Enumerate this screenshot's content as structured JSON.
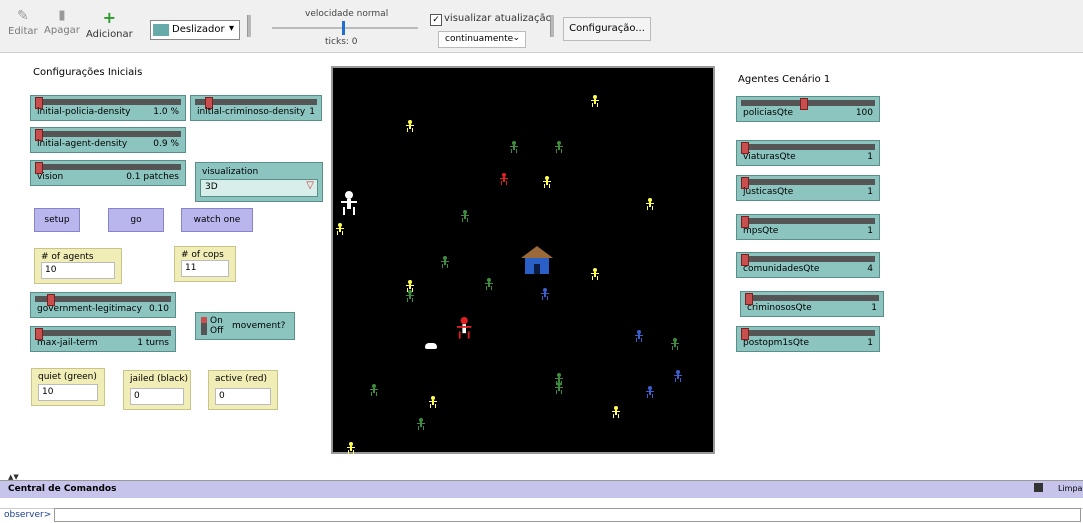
{
  "toolbar": {
    "edit_label": "Editar",
    "delete_label": "Apagar",
    "add_label": "Adicionar",
    "widget_type": "Deslizador",
    "speed_label": "velocidade normal",
    "ticks_label": "ticks: 0",
    "view_updates_label": "visualizar atualização",
    "view_updates_checked": true,
    "update_mode": "continuamente",
    "settings_label": "Configuração..."
  },
  "left_panel": {
    "title": "Configurações Iniciais",
    "sliders": {
      "initial_policia": {
        "name": "initial-policia-density",
        "value": "1.0 %",
        "level": 0.01
      },
      "initial_criminoso": {
        "name": "initial-criminoso-density",
        "value": "1",
        "level": 0.01
      },
      "initial_agent": {
        "name": "initial-agent-density",
        "value": "0.9 %",
        "level": 0.009
      },
      "vision": {
        "name": "vision",
        "value": "0.1 patches",
        "level": 0.0
      },
      "government_legitimacy": {
        "name": "government-legitimacy",
        "value": "0.10",
        "level": 0.1
      },
      "max_jail_term": {
        "name": "max-jail-term",
        "value": "1 turns",
        "level": 0.0
      }
    },
    "chooser": {
      "label": "visualization",
      "value": "3D"
    },
    "buttons": {
      "setup": "setup",
      "go": "go",
      "watch_one": "watch one"
    },
    "monitors": {
      "agents": {
        "label": "# of agents",
        "value": "10"
      },
      "cops": {
        "label": "# of cops",
        "value": "11"
      },
      "quiet": {
        "label": "quiet (green)",
        "value": "10"
      },
      "jailed": {
        "label": "jailed (black)",
        "value": "0"
      },
      "active": {
        "label": "active (red)",
        "value": "0"
      }
    },
    "switch": {
      "on": "On",
      "off": "Off",
      "label": "movement?"
    }
  },
  "right_panel": {
    "title": "Agentes Cenário 1",
    "sliders": [
      {
        "name": "policiasQte",
        "value": "100",
        "level": 0.45
      },
      {
        "name": "viaturasQte",
        "value": "1",
        "level": 0.0
      },
      {
        "name": "justicasQte",
        "value": "1",
        "level": 0.0
      },
      {
        "name": "mpsQte",
        "value": "1",
        "level": 0.0
      },
      {
        "name": "comunidadesQte",
        "value": "4",
        "level": 0.0
      },
      {
        "name": "criminososQte",
        "value": "1",
        "level": 0.0
      },
      {
        "name": "postopm1sQte",
        "value": "1",
        "level": 0.0
      }
    ]
  },
  "command_center": {
    "title": "Central de Comandos",
    "clear_label": "Limpar",
    "prompt": "observer>"
  },
  "colors": {
    "slider_bg": "#8cc5bf",
    "button_bg": "#b9b6ee",
    "monitor_bg": "#f0edb6",
    "citizen": "#ffff55",
    "quiet": "#3e8c3e",
    "cop": "#3b5fcf",
    "active": "#e02020"
  }
}
